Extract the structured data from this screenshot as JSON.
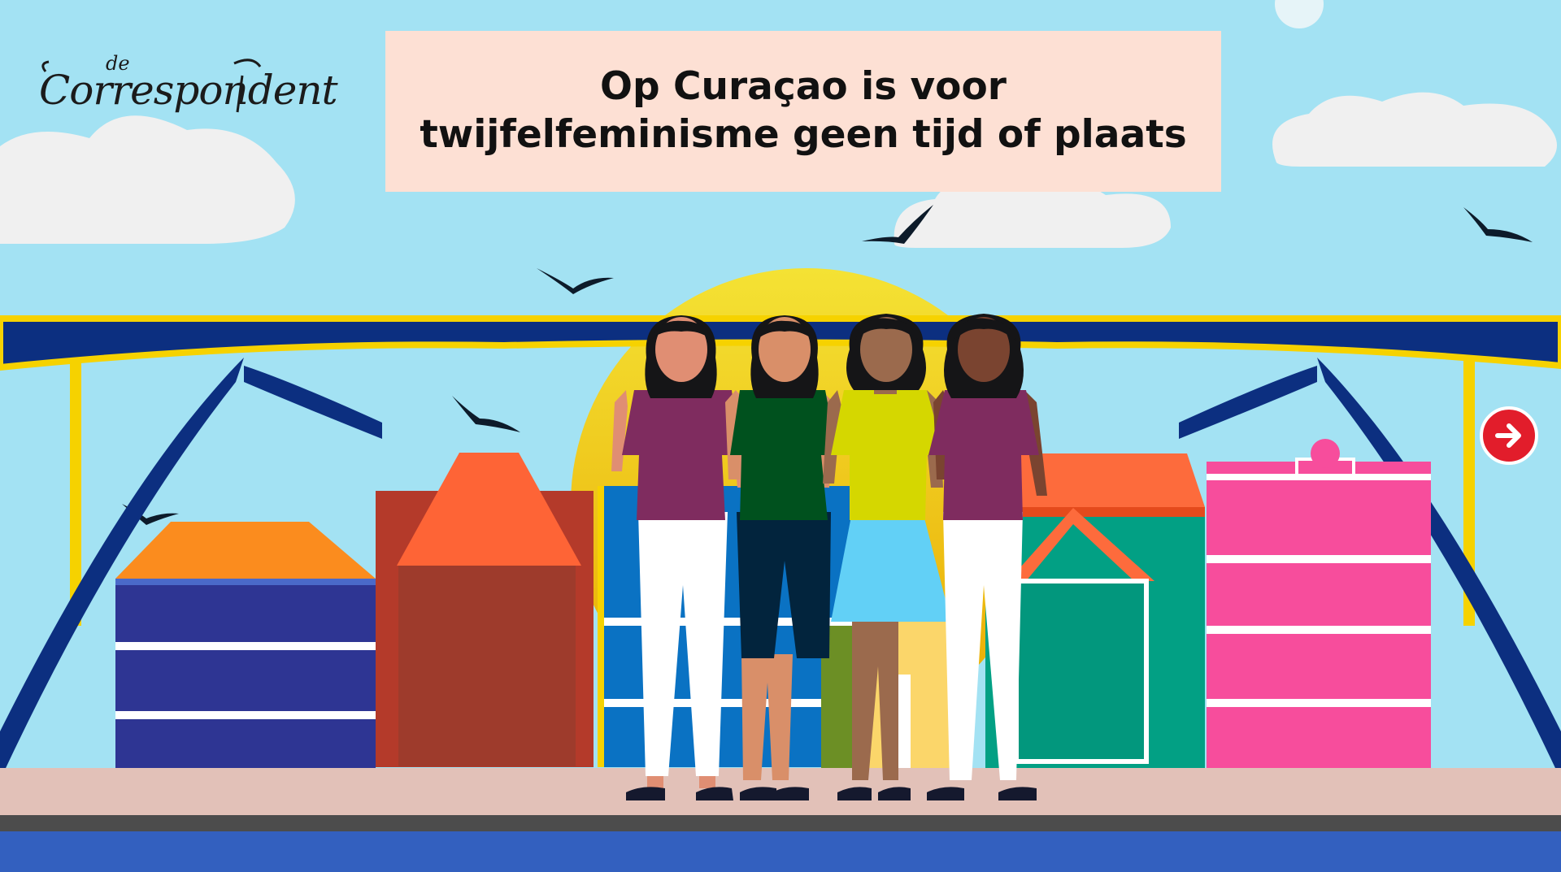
{
  "logo": {
    "prefix": "de",
    "name": "Correspondent"
  },
  "title": {
    "line1": "Op Curaçao is voor",
    "line2": "twijfelfeminisme geen tijd of plaats"
  },
  "icons": {
    "next": "arrow-right-icon",
    "bird": "bird-icon"
  },
  "colors": {
    "sky": "#a3e2f3",
    "sun": "#f2c400",
    "bridge": "#0c2f80",
    "bridge_trim": "#f6d200",
    "title_bg": "#fde0d4",
    "next_button": "#e21d2b",
    "water": "#3360bf",
    "quay": "#e2c1b8"
  }
}
